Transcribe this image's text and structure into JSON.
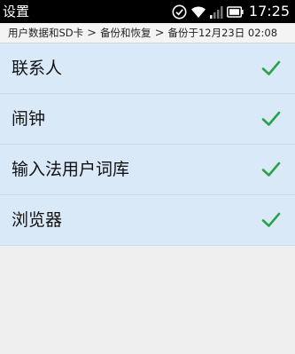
{
  "status_bar": {
    "title": "设置",
    "time": "17:25",
    "icons": [
      "check-circle-icon",
      "wifi-icon",
      "signal-icon",
      "battery-icon"
    ]
  },
  "breadcrumb": {
    "items": [
      "用户数据和SD卡",
      "备份和恢复",
      "备份于12月23日 02:08"
    ],
    "separator": ">"
  },
  "items": [
    {
      "label": "联系人",
      "checked": true
    },
    {
      "label": "闹钟",
      "checked": true
    },
    {
      "label": "输入法用户词库",
      "checked": true
    },
    {
      "label": "浏览器",
      "checked": true
    }
  ],
  "colors": {
    "accent_check": "#2aa24a",
    "item_background": "#dae9f8",
    "status_bar": "#000000"
  }
}
